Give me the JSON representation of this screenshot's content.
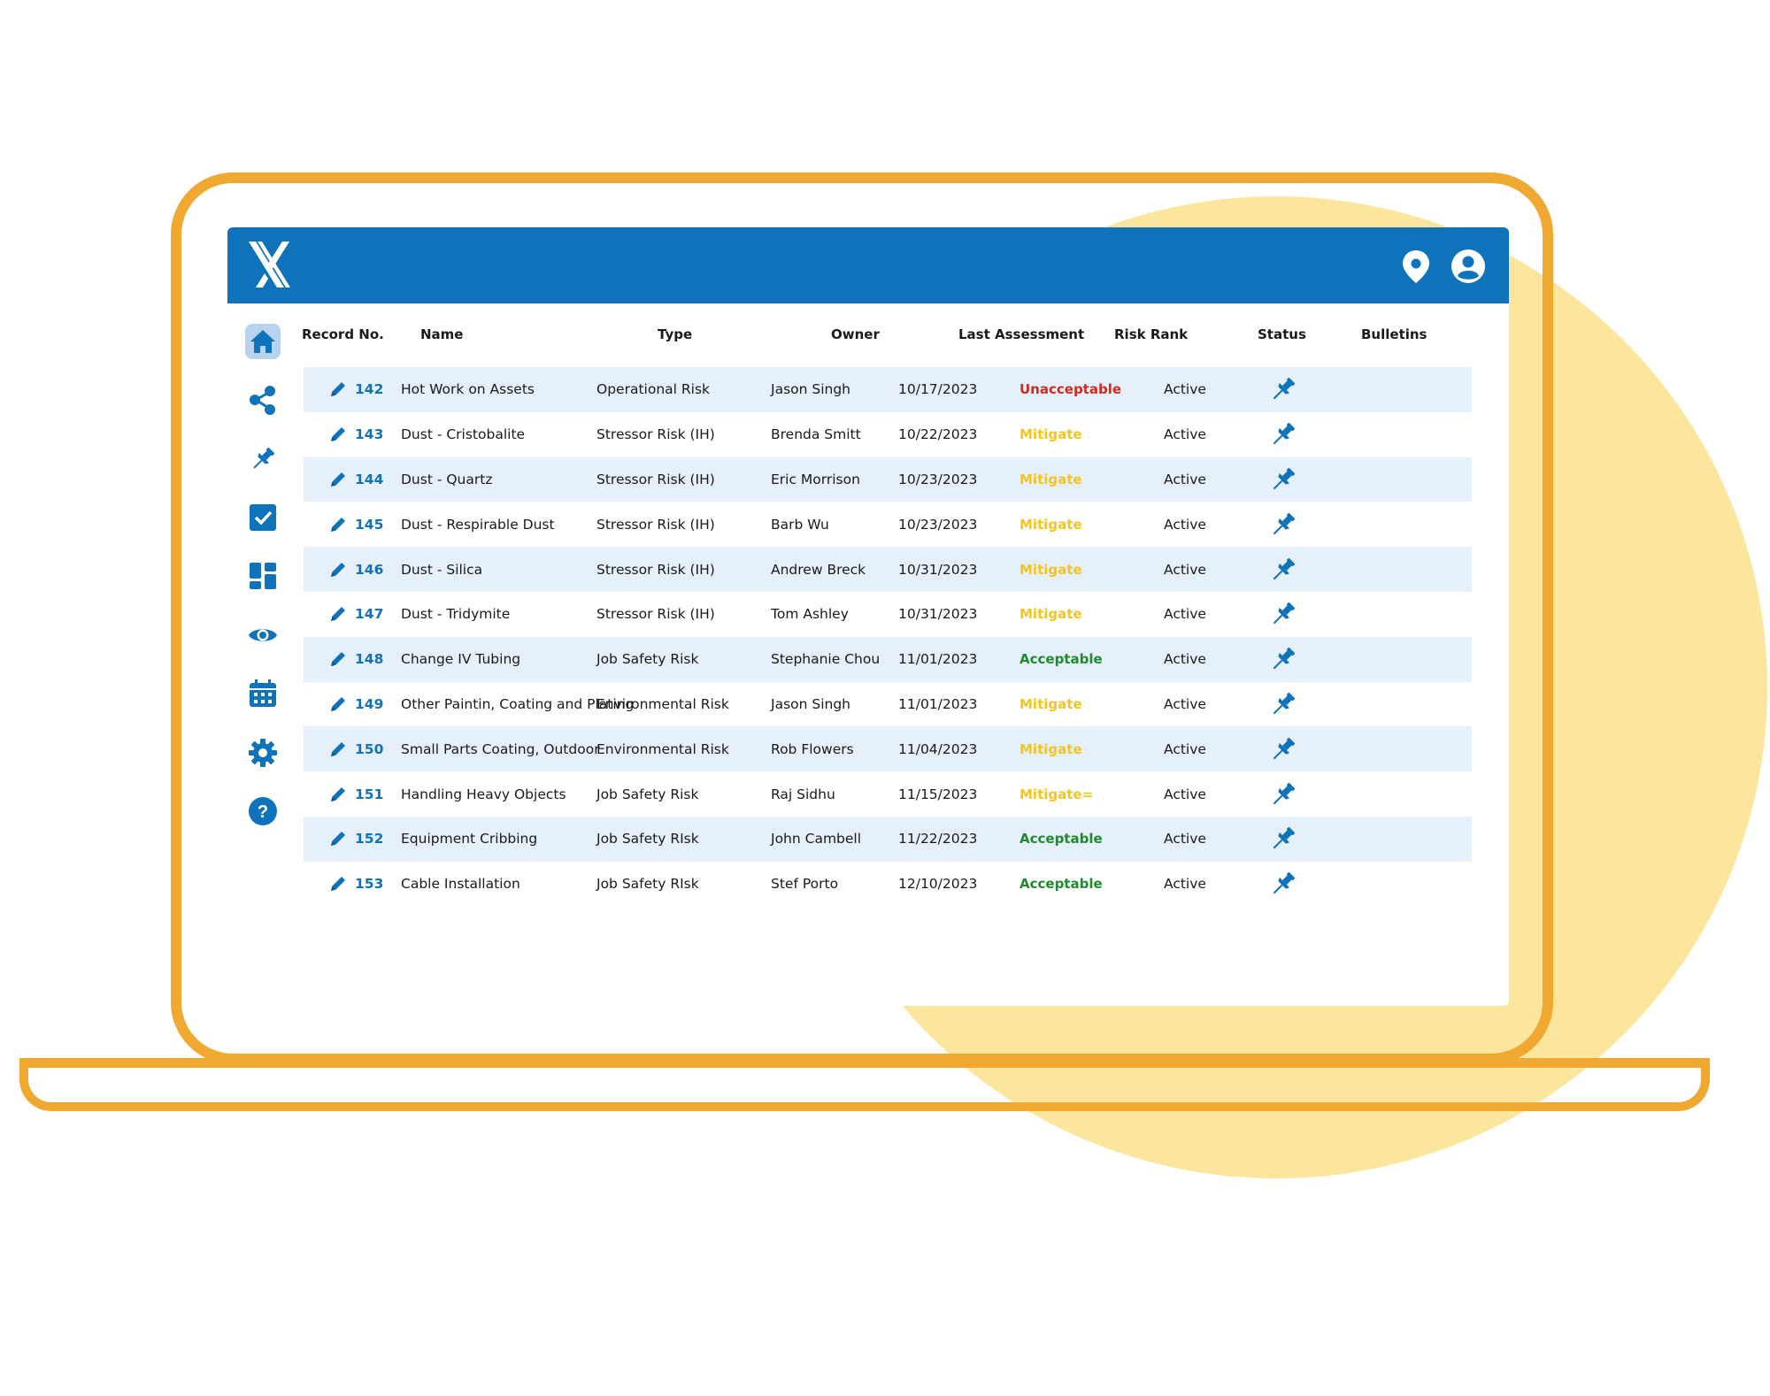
{
  "colors": {
    "primary": "#0e73ba",
    "row_alt": "#e5f0fb",
    "laptop_outline": "#f0a830",
    "deco_circle": "#fce59d",
    "unacceptable": "#d42a1e",
    "mitigate": "#f5c518",
    "acceptable": "#1f8a2e"
  },
  "header": {
    "logo_icon": "x-logo-icon",
    "icons": [
      "location-pin-icon",
      "user-account-icon"
    ]
  },
  "sidebar": {
    "items": [
      {
        "icon": "home-icon",
        "active": true
      },
      {
        "icon": "share-icon"
      },
      {
        "icon": "pushpin-icon"
      },
      {
        "icon": "checkbox-icon"
      },
      {
        "icon": "dashboard-icon"
      },
      {
        "icon": "eye-icon"
      },
      {
        "icon": "calendar-icon"
      },
      {
        "icon": "gear-icon"
      },
      {
        "icon": "help-icon"
      }
    ]
  },
  "table": {
    "columns": [
      "Record No.",
      "Name",
      "Type",
      "Owner",
      "Last Assessment",
      "Risk Rank",
      "Status",
      "Bulletins"
    ],
    "rows": [
      {
        "record": "142",
        "name": "Hot Work on Assets",
        "type": "Operational Risk",
        "owner": "Jason Singh",
        "date": "10/17/2023",
        "rank": "Unacceptable",
        "rank_level": "unacceptable",
        "status": "Active"
      },
      {
        "record": "143",
        "name": "Dust - Cristobalite",
        "type": "Stressor Risk (IH)",
        "owner": "Brenda Smitt",
        "date": "10/22/2023",
        "rank": "Mitigate",
        "rank_level": "mitigate",
        "status": "Active"
      },
      {
        "record": "144",
        "name": "Dust - Quartz",
        "type": "Stressor Risk (IH)",
        "owner": "Eric Morrison",
        "date": "10/23/2023",
        "rank": "Mitigate",
        "rank_level": "mitigate",
        "status": "Active"
      },
      {
        "record": "145",
        "name": "Dust - Respirable Dust",
        "type": "Stressor Risk (IH)",
        "owner": "Barb Wu",
        "date": "10/23/2023",
        "rank": "Mitigate",
        "rank_level": "mitigate",
        "status": "Active"
      },
      {
        "record": "146",
        "name": "Dust - Silica",
        "type": "Stressor Risk (IH)",
        "owner": "Andrew Breck",
        "date": "10/31/2023",
        "rank": "Mitigate",
        "rank_level": "mitigate",
        "status": "Active"
      },
      {
        "record": "147",
        "name": "Dust - Tridymite",
        "type": "Stressor Risk (IH)",
        "owner": "Tom Ashley",
        "date": "10/31/2023",
        "rank": "Mitigate",
        "rank_level": "mitigate",
        "status": "Active"
      },
      {
        "record": "148",
        "name": "Change IV Tubing",
        "type": "Job Safety Risk",
        "owner": "Stephanie Chou",
        "date": "11/01/2023",
        "rank": "Acceptable",
        "rank_level": "acceptable",
        "status": "Active"
      },
      {
        "record": "149",
        "name": "Other Paintin, Coating and Plating",
        "type": "Environmental Risk",
        "owner": "Jason Singh",
        "date": "11/01/2023",
        "rank": "Mitigate",
        "rank_level": "mitigate",
        "status": "Active"
      },
      {
        "record": "150",
        "name": "Small Parts Coating, Outdoor",
        "type": "Environmental Risk",
        "owner": "Rob Flowers",
        "date": "11/04/2023",
        "rank": "Mitigate",
        "rank_level": "mitigate",
        "status": "Active"
      },
      {
        "record": "151",
        "name": "Handling Heavy Objects",
        "type": "Job Safety Risk",
        "owner": "Raj Sidhu",
        "date": "11/15/2023",
        "rank": "Mitigate=",
        "rank_level": "mitigate",
        "status": "Active"
      },
      {
        "record": "152",
        "name": "Equipment Cribbing",
        "type": "Job Safety RIsk",
        "owner": "John Cambell",
        "date": "11/22/2023",
        "rank": "Acceptable",
        "rank_level": "acceptable",
        "status": "Active"
      },
      {
        "record": "153",
        "name": "Cable Installation",
        "type": "Job Safety RIsk",
        "owner": "Stef Porto",
        "date": "12/10/2023",
        "rank": "Acceptable",
        "rank_level": "acceptable",
        "status": "Active"
      }
    ]
  }
}
